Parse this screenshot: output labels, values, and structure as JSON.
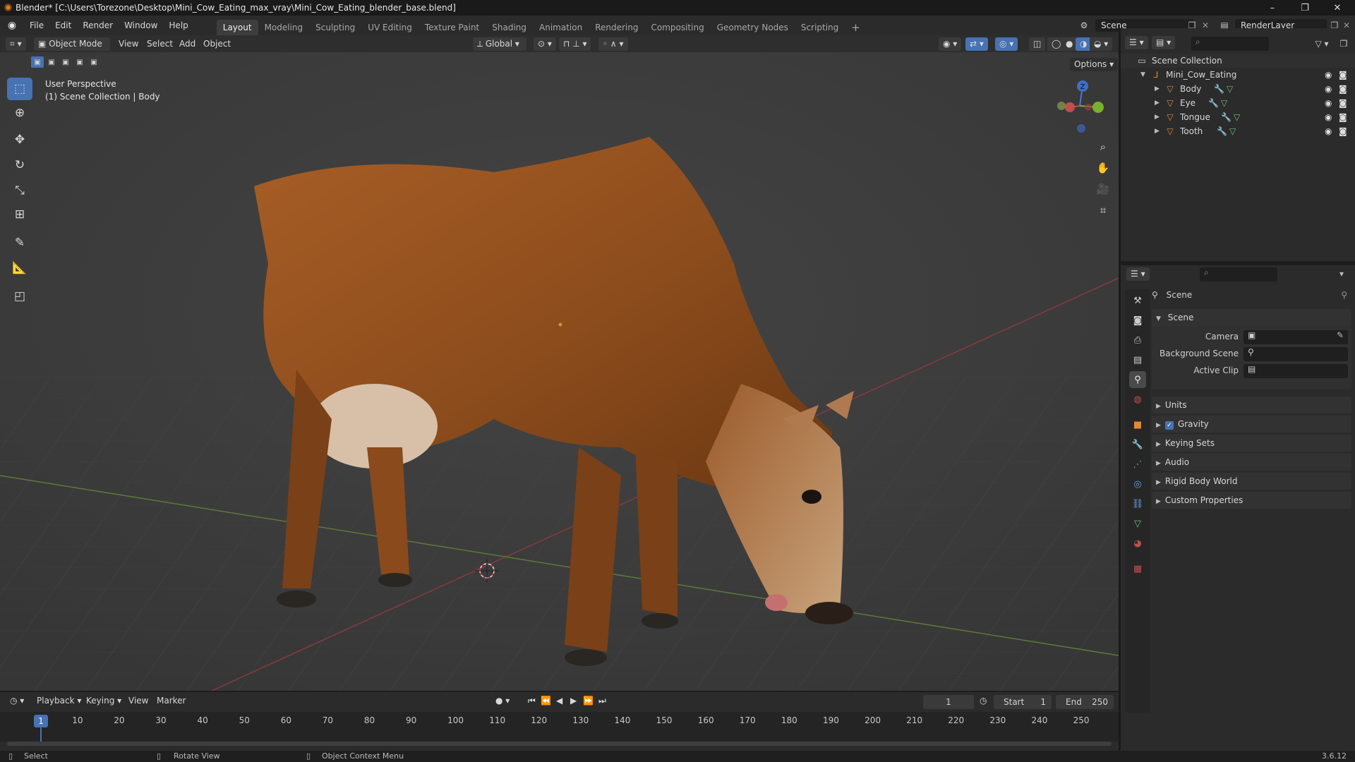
{
  "title_bar": {
    "title": "Blender* [C:\\Users\\Torezone\\Desktop\\Mini_Cow_Eating_max_vray\\Mini_Cow_Eating_blender_base.blend]"
  },
  "menu": {
    "items": [
      "File",
      "Edit",
      "Render",
      "Window",
      "Help"
    ]
  },
  "workspace_tabs": [
    "Layout",
    "Modeling",
    "Sculpting",
    "UV Editing",
    "Texture Paint",
    "Shading",
    "Animation",
    "Rendering",
    "Compositing",
    "Geometry Nodes",
    "Scripting"
  ],
  "scene_selector": {
    "scene": "Scene",
    "render_layer": "RenderLayer"
  },
  "viewport_header": {
    "mode": "Object Mode",
    "menus": [
      "View",
      "Select",
      "Add",
      "Object"
    ],
    "orientation": "Global",
    "options": "Options"
  },
  "viewport": {
    "line1": "User Perspective",
    "line2": "(1) Scene Collection | Body",
    "gizmo_z": "Z"
  },
  "outliner": {
    "root": "Scene Collection",
    "collection": "Mini_Cow_Eating",
    "objects": [
      "Body",
      "Eye",
      "Tongue",
      "Tooth"
    ]
  },
  "properties": {
    "header": "Scene",
    "section": "Scene",
    "fields": [
      "Camera",
      "Background Scene",
      "Active Clip"
    ],
    "panels": [
      "Units",
      "Gravity",
      "Keying Sets",
      "Audio",
      "Rigid Body World",
      "Custom Properties"
    ]
  },
  "timeline": {
    "menus": [
      "Playback",
      "Keying",
      "View",
      "Marker"
    ],
    "current_frame": "1",
    "start_label": "Start",
    "start": "1",
    "end_label": "End",
    "end": "250",
    "ticks": [
      "1",
      "10",
      "20",
      "30",
      "40",
      "50",
      "60",
      "70",
      "80",
      "90",
      "100",
      "110",
      "120",
      "130",
      "140",
      "150",
      "160",
      "170",
      "180",
      "190",
      "200",
      "210",
      "220",
      "230",
      "240",
      "250"
    ]
  },
  "status_bar": {
    "select": "Select",
    "rotate": "Rotate View",
    "context": "Object Context Menu",
    "version": "3.6.12"
  },
  "colors": {
    "accent": "#4772b3",
    "object_orange": "#e08a3a",
    "mesh_green": "#6ec07a",
    "x_axis": "#c0392b",
    "y_axis": "#7aa84a"
  }
}
